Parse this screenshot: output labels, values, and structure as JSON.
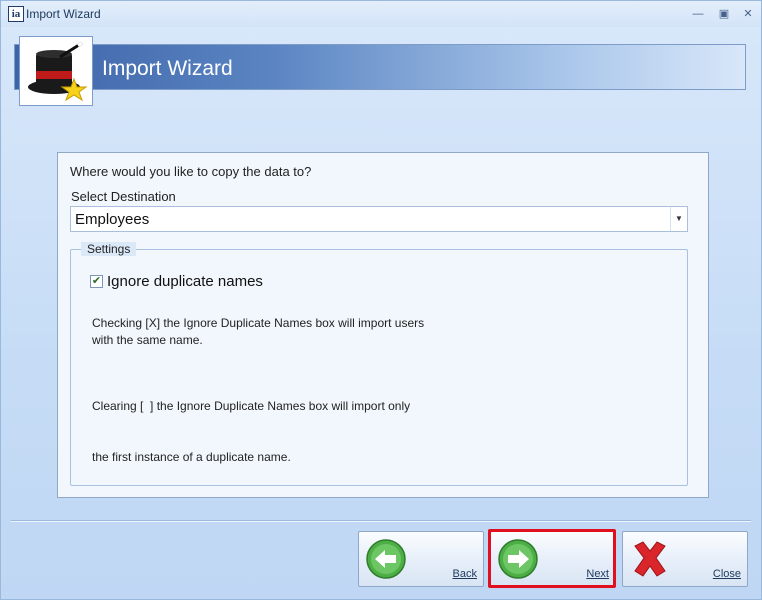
{
  "window": {
    "title": "Import Wizard",
    "app_icon_text": "ia"
  },
  "header": {
    "title": "Import Wizard",
    "logo_icon": "magic-top-hat-icon"
  },
  "main": {
    "question": "Where would you like to copy the data to?",
    "destination_label": "Select Destination",
    "destination_value": "Employees",
    "settings_legend": "Settings",
    "ignore_duplicates_label": "Ignore duplicate names",
    "ignore_duplicates_checked": true,
    "desc_checked_line1": "Checking [X] the Ignore Duplicate Names box will import users",
    "desc_checked_line2": "with the same name.",
    "desc_cleared_line1": "Clearing [  ] the Ignore Duplicate Names box will import only",
    "desc_cleared_line2": "the first instance of a duplicate name."
  },
  "footer": {
    "back_label": "Back",
    "next_label": "Next",
    "close_label": "Close"
  },
  "colors": {
    "accent_green": "#4cae45",
    "close_red": "#d9262b",
    "highlight": "#e0101f"
  }
}
